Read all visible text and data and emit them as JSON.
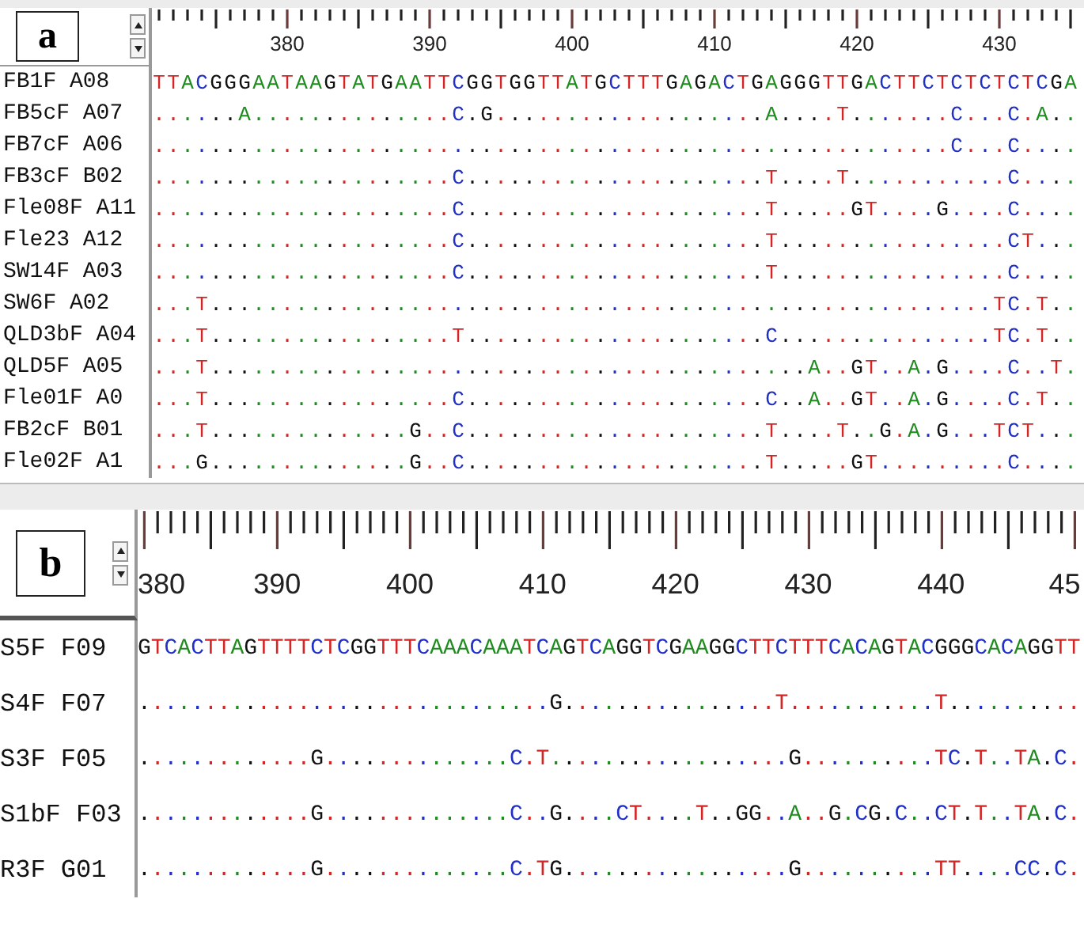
{
  "panels": [
    {
      "label": "a",
      "ruler": [
        "380",
        "390",
        "400",
        "410",
        "420",
        "430"
      ],
      "sequences": [
        {
          "name": "FB1F A08",
          "bases": "TTACGGGAATAAGTATGAATTCGGTGGTTATGCTTTGAGACTGAGGGTTGACTTCTCTCTCTCGA"
        },
        {
          "name": "FB5cF A07",
          "bases": "......A..............C.G...................A....T.......C...C.A.."
        },
        {
          "name": "FB7cF A06",
          "bases": "........................................................C...C...."
        },
        {
          "name": "FB3cF B02",
          "bases": ".....................C.....................T....T...........C...."
        },
        {
          "name": "Fle08F A11",
          "bases": ".....................C.....................T.....GT....G....C...."
        },
        {
          "name": "Fle23 A12",
          "bases": ".....................C.....................T................CT..."
        },
        {
          "name": "SW14F A03",
          "bases": ".....................C.....................T................C...."
        },
        {
          "name": "SW6F A02",
          "bases": "...T.......................................................TC.T.."
        },
        {
          "name": "QLD3bF A04",
          "bases": "...T.................T.....................C...............TC.T.."
        },
        {
          "name": "QLD5F A05",
          "bases": "...T..........................................A..GT..A.G....C..T."
        },
        {
          "name": "Fle01F A0",
          "bases": "...T.................C.....................C..A..GT..A.G....C.T.."
        },
        {
          "name": "FB2cF B01",
          "bases": "...T..............G..C.....................T....T..G.A.G...TCT..."
        },
        {
          "name": "Fle02F A1",
          "bases": "...G..............G..C.....................T.....GT.........C...."
        }
      ]
    },
    {
      "label": "b",
      "ruler": [
        "380",
        "390",
        "400",
        "410",
        "420",
        "430",
        "440",
        "45"
      ],
      "sequences": [
        {
          "name": "S5F F09",
          "bases": "GTCACTTAGTTTTCTCGGTTTCAAACAAATCAGTCAGGTCGAAGGCTTCTTTCACAGTACGGGCACAGGTT"
        },
        {
          "name": "S4F F07",
          "bases": "...............................G................T...........T.........."
        },
        {
          "name": "S3F F05",
          "bases": ".............G..............C.T..................G..........TC.T..TA.C."
        },
        {
          "name": "S1bF F03",
          "bases": ".............G..............C..G....CT....T..GG..A..G.CG.C..CT.T..TA.C."
        },
        {
          "name": "R3F G01",
          "bases": ".............G..............C.TG.................G..........TT....CC.C."
        }
      ]
    }
  ]
}
